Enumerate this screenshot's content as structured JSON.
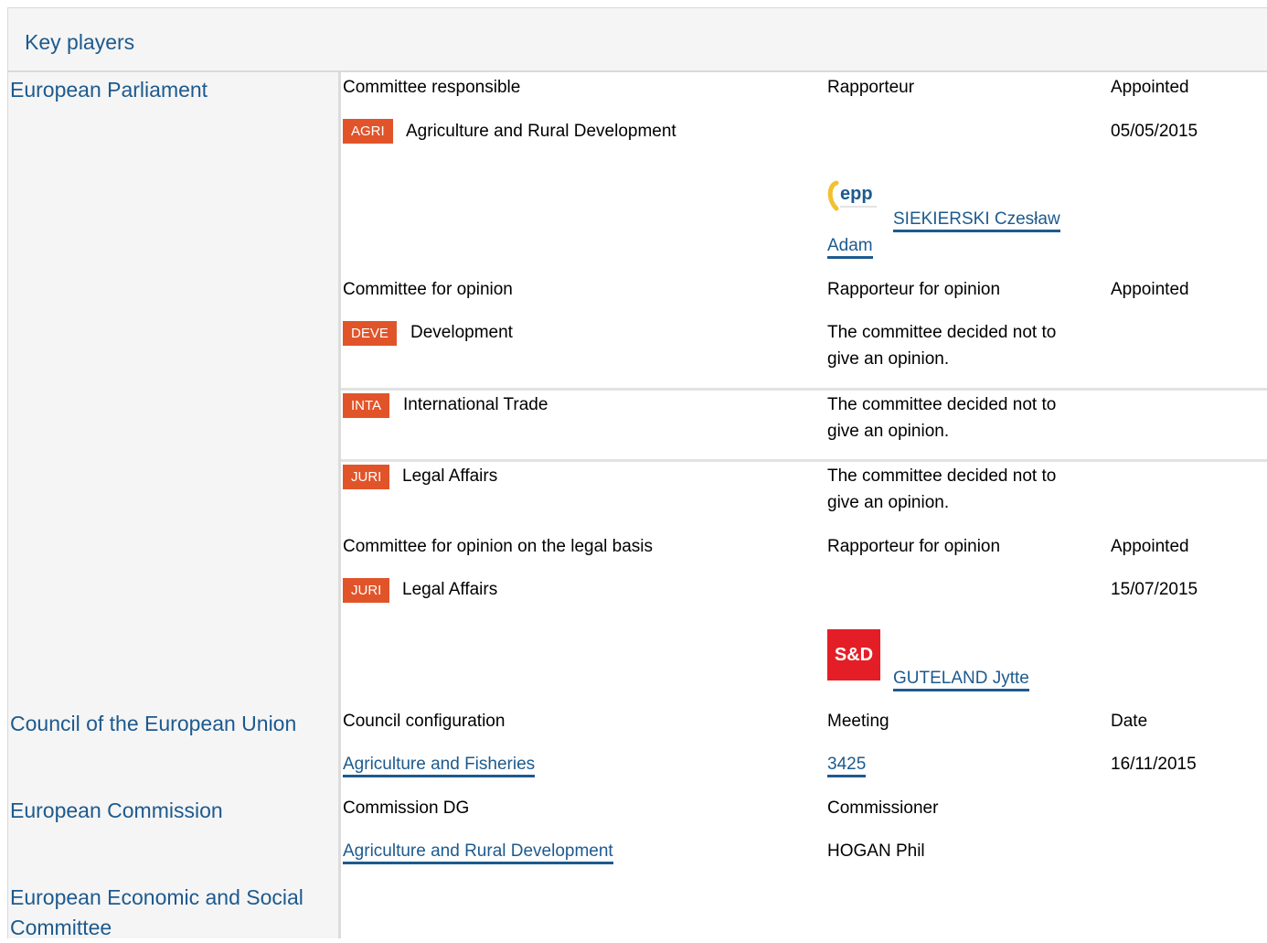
{
  "header": {
    "title": "Key players"
  },
  "sections": {
    "ep": {
      "label": "European Parliament"
    },
    "council": {
      "label": "Council of the European Union"
    },
    "commission": {
      "label": "European Commission"
    },
    "eesc": {
      "label": "European Economic and Social Committee"
    }
  },
  "ep": {
    "responsible": {
      "col1": "Committee responsible",
      "col2": "Rapporteur",
      "col3": "Appointed",
      "badge": "AGRI",
      "name": "Agriculture and Rural Development",
      "date": "05/05/2015",
      "rapporteur": {
        "party": "epp",
        "line1": "SIEKIERSKI Czesław",
        "line2": "Adam"
      }
    },
    "opinion": {
      "col1": "Committee for opinion",
      "col2": "Rapporteur for opinion",
      "col3": "Appointed",
      "rows": [
        {
          "badge": "DEVE",
          "name": "Development",
          "note_l1": "The committee decided not to",
          "note_l2": "give an opinion."
        },
        {
          "badge": "INTA",
          "name": "International Trade",
          "note_l1": "The committee decided not to",
          "note_l2": "give an opinion."
        },
        {
          "badge": "JURI",
          "name": "Legal Affairs",
          "note_l1": "The committee decided not to",
          "note_l2": "give an opinion."
        }
      ]
    },
    "legal_basis": {
      "col1": "Committee for opinion on the legal basis",
      "col2": "Rapporteur for opinion",
      "col3": "Appointed",
      "badge": "JURI",
      "name": "Legal Affairs",
      "date": "15/07/2015",
      "rapporteur": {
        "party": "S&D",
        "name": "GUTELAND Jytte"
      }
    }
  },
  "council": {
    "col1": "Council configuration",
    "col2": "Meeting",
    "col3": "Date",
    "config": "Agriculture and Fisheries",
    "meeting": "3425",
    "date": "16/11/2015"
  },
  "commission": {
    "col1": "Commission DG",
    "col2": "Commissioner",
    "dg": "Agriculture and Rural Development",
    "commissioner": "HOGAN Phil"
  }
}
